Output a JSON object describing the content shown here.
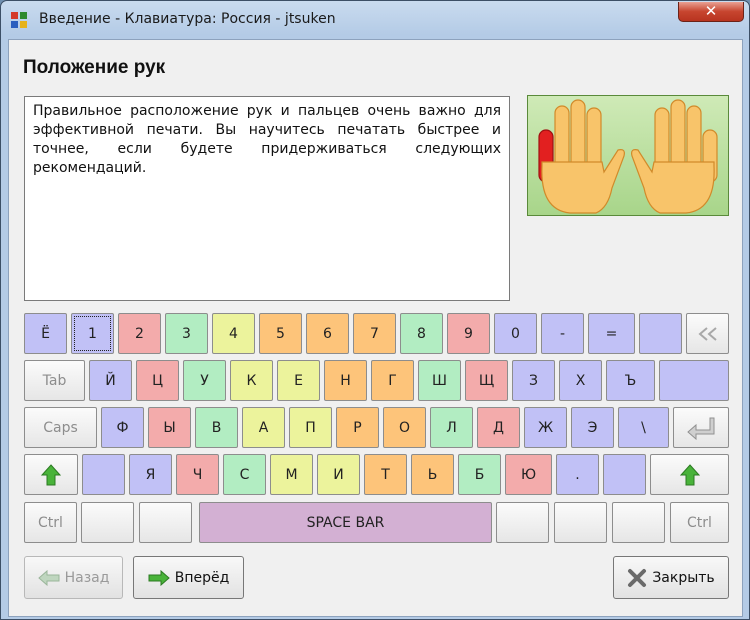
{
  "window": {
    "title": "Введение - Клавиатура: Россия - jtsuken",
    "close_label": "✕"
  },
  "page": {
    "heading": "Положение рук",
    "description": "Правильное расположение рук и пальцев очень важно для эффективной печати. Вы научитесь печатать быстрее и точнее, если будете придерживаться следующих рекомендаций."
  },
  "colors": {
    "blue": "#c1c1f6",
    "pink": "#f3abab",
    "green": "#b2edc2",
    "yellow": "#ecf39c",
    "orange": "#fdc47a",
    "space": "#d3b0d3",
    "finger_highlight": "#e02020"
  },
  "keyboard": {
    "rows": [
      [
        {
          "label": "Ё",
          "color": "blue"
        },
        {
          "label": "1",
          "color": "blue",
          "focused": true
        },
        {
          "label": "2",
          "color": "pink"
        },
        {
          "label": "3",
          "color": "green"
        },
        {
          "label": "4",
          "color": "yellow"
        },
        {
          "label": "5",
          "color": "orange"
        },
        {
          "label": "6",
          "color": "orange"
        },
        {
          "label": "7",
          "color": "orange"
        },
        {
          "label": "8",
          "color": "green"
        },
        {
          "label": "9",
          "color": "pink"
        },
        {
          "label": "0",
          "color": "blue"
        },
        {
          "label": "-",
          "color": "blue"
        },
        {
          "label": "=",
          "color": "blue"
        },
        {
          "label": "",
          "color": "blue"
        },
        {
          "label": "",
          "icon": "backspace-icon",
          "color": "gray"
        }
      ],
      [
        {
          "label": "Tab",
          "color": "gray"
        },
        {
          "label": "Й",
          "color": "blue"
        },
        {
          "label": "Ц",
          "color": "pink"
        },
        {
          "label": "У",
          "color": "green"
        },
        {
          "label": "К",
          "color": "yellow"
        },
        {
          "label": "Е",
          "color": "yellow"
        },
        {
          "label": "Н",
          "color": "orange"
        },
        {
          "label": "Г",
          "color": "orange"
        },
        {
          "label": "Ш",
          "color": "green"
        },
        {
          "label": "Щ",
          "color": "pink"
        },
        {
          "label": "З",
          "color": "blue"
        },
        {
          "label": "Х",
          "color": "blue"
        },
        {
          "label": "Ъ",
          "color": "blue"
        },
        {
          "label": "",
          "color": "blue"
        }
      ],
      [
        {
          "label": "Caps",
          "color": "gray"
        },
        {
          "label": "Ф",
          "color": "blue"
        },
        {
          "label": "Ы",
          "color": "pink"
        },
        {
          "label": "В",
          "color": "green"
        },
        {
          "label": "А",
          "color": "yellow"
        },
        {
          "label": "П",
          "color": "yellow"
        },
        {
          "label": "Р",
          "color": "orange"
        },
        {
          "label": "О",
          "color": "orange"
        },
        {
          "label": "Л",
          "color": "green"
        },
        {
          "label": "Д",
          "color": "pink"
        },
        {
          "label": "Ж",
          "color": "blue"
        },
        {
          "label": "Э",
          "color": "blue"
        },
        {
          "label": "\\",
          "color": "blue"
        },
        {
          "label": "",
          "icon": "enter-icon",
          "color": "gray"
        }
      ],
      [
        {
          "label": "",
          "icon": "shift-icon",
          "color": "gray"
        },
        {
          "label": "",
          "color": "blue"
        },
        {
          "label": "Я",
          "color": "blue"
        },
        {
          "label": "Ч",
          "color": "pink"
        },
        {
          "label": "С",
          "color": "green"
        },
        {
          "label": "М",
          "color": "yellow"
        },
        {
          "label": "И",
          "color": "yellow"
        },
        {
          "label": "Т",
          "color": "orange"
        },
        {
          "label": "Ь",
          "color": "orange"
        },
        {
          "label": "Б",
          "color": "green"
        },
        {
          "label": "Ю",
          "color": "pink"
        },
        {
          "label": ".",
          "color": "blue"
        },
        {
          "label": "",
          "color": "blue"
        },
        {
          "label": "",
          "icon": "shift-icon",
          "color": "gray"
        }
      ],
      [
        {
          "label": "Ctrl",
          "color": "gray"
        },
        {
          "label": "",
          "color": "gray"
        },
        {
          "label": "",
          "color": "gray"
        },
        {
          "label": "SPACE BAR",
          "color": "space"
        },
        {
          "label": "",
          "color": "gray"
        },
        {
          "label": "",
          "color": "gray"
        },
        {
          "label": "",
          "color": "gray"
        },
        {
          "label": "Ctrl",
          "color": "gray"
        }
      ]
    ]
  },
  "buttons": {
    "back": "Назад",
    "forward": "Вперёд",
    "close": "Закрыть"
  }
}
